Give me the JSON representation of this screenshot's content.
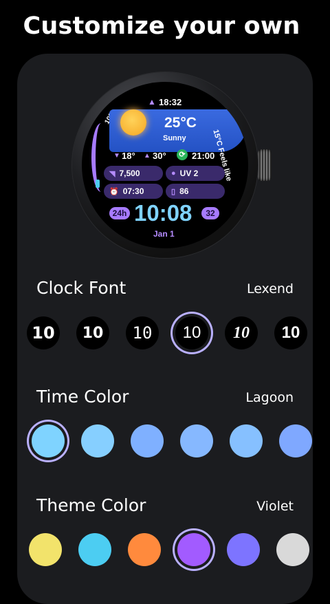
{
  "headline": "Customize your own",
  "watch": {
    "sunset_time": "18:32",
    "temperature": "25°C",
    "condition": "Sunny",
    "low": "18°",
    "high": "30°",
    "sync_time": "21:00",
    "feels_like": "15°C Feels like",
    "battery_scale": "100",
    "steps": "7,500",
    "uv": "UV 2",
    "alarm": "07:30",
    "phone_battery": "86",
    "format": "24h",
    "time": "10:08",
    "week": "32",
    "date": "Jan 1"
  },
  "clock_font": {
    "label": "Clock Font",
    "value": "Lexend",
    "options": [
      "10",
      "10",
      "10",
      "10",
      "10",
      "10"
    ],
    "selected_index": 3
  },
  "time_color": {
    "label": "Time Color",
    "value": "Lagoon",
    "swatches": [
      "#7fd3ff",
      "#86cfff",
      "#7fb0ff",
      "#86b8ff",
      "#86c0ff",
      "#7fa8ff"
    ],
    "selected_index": 0
  },
  "theme_color": {
    "label": "Theme Color",
    "value": "Violet",
    "swatches": [
      "#f2e36b",
      "#4ccdf2",
      "#ff8a3d",
      "#a25bff",
      "#7d74ff",
      "#d9d9d9"
    ],
    "selected_index": 3
  }
}
